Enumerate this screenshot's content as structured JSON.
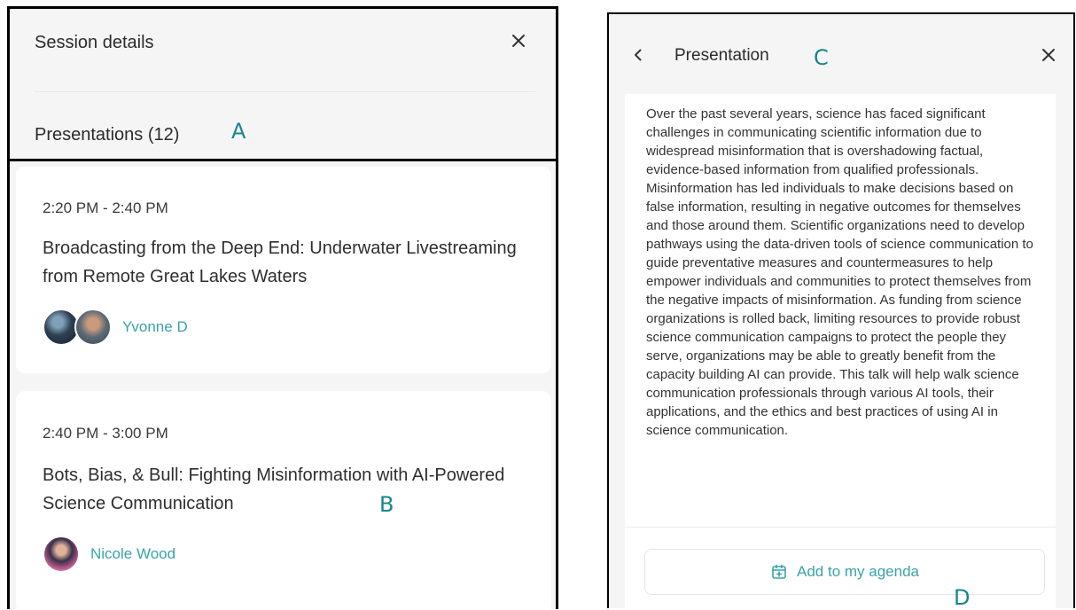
{
  "left_panel": {
    "title": "Session details",
    "section_title": "Presentations (12)",
    "presentations": [
      {
        "time": "2:20 PM - 2:40 PM",
        "title": "Broadcasting from the Deep End: Underwater Livestreaming from Remote Great Lakes Waters",
        "speaker": "Yvonne D"
      },
      {
        "time": "2:40 PM - 3:00 PM",
        "title": "Bots, Bias, & Bull: Fighting Misinformation with AI-Powered Science Communication",
        "speaker": "Nicole Wood"
      }
    ]
  },
  "right_panel": {
    "title": "Presentation",
    "description": "Over the past several years, science has faced significant challenges in communicating scientific information due to widespread misinformation that is overshadowing factual, evidence-based information from qualified professionals. Misinformation has led individuals to make decisions based on false information, resulting in negative outcomes for themselves and those around them. Scientific organizations need to develop pathways using the data-driven tools of science communication to guide preventative measures and countermeasures to help empower individuals and communities to protect themselves from the negative impacts of misinformation. As funding from science organizations is rolled back, limiting resources to provide robust science communication campaigns to protect the people they serve, organizations may be able to greatly benefit from the capacity building AI can provide. This talk will help walk science communication professionals through various AI tools, their applications, and the ethics and best practices of using AI in science communication.",
    "agenda_button": "Add to my agenda"
  },
  "annotations": {
    "a": "A",
    "b": "B",
    "c": "C",
    "d": "D"
  },
  "colors": {
    "accent": "#3aa3a8",
    "callout": "#17868c",
    "panel_bg": "#f5f5f6"
  },
  "icons": [
    "close-icon",
    "back-chevron-icon",
    "calendar-add-icon",
    "avatar"
  ]
}
